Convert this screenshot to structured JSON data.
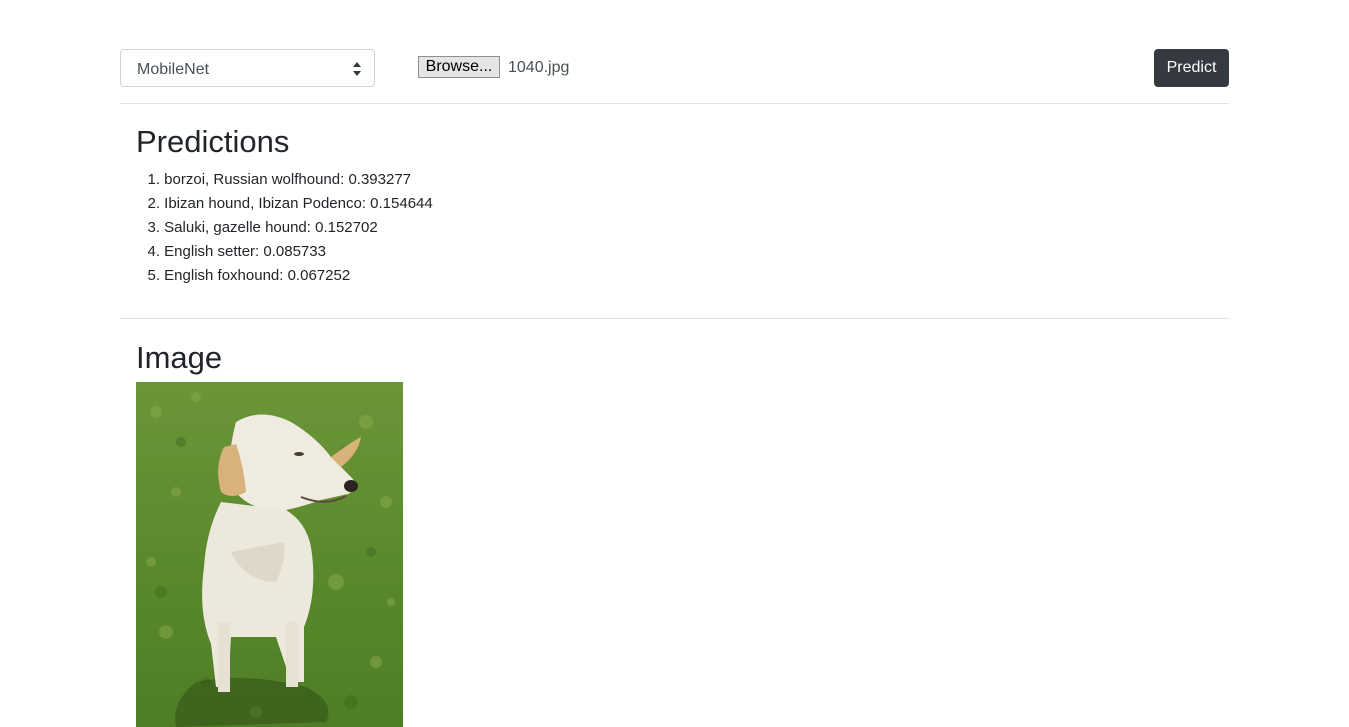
{
  "toolbar": {
    "model_select": {
      "selected": "MobileNet"
    },
    "file_input": {
      "button_label": "Browse...",
      "file_name": "1040.jpg"
    },
    "predict_label": "Predict"
  },
  "predictions": {
    "title": "Predictions",
    "items": [
      {
        "num": "1.",
        "text": "borzoi, Russian wolfhound: 0.393277"
      },
      {
        "num": "2.",
        "text": "Ibizan hound, Ibizan Podenco: 0.154644"
      },
      {
        "num": "3.",
        "text": "Saluki, gazelle hound: 0.152702"
      },
      {
        "num": "4.",
        "text": "English setter: 0.085733"
      },
      {
        "num": "5.",
        "text": "English foxhound: 0.067252"
      }
    ]
  },
  "image_section": {
    "title": "Image"
  },
  "colors": {
    "predict_button_bg": "#343a40",
    "divider": "#e2e4e6",
    "grass": "#5f8a2e",
    "dog": "#ece8dc"
  }
}
